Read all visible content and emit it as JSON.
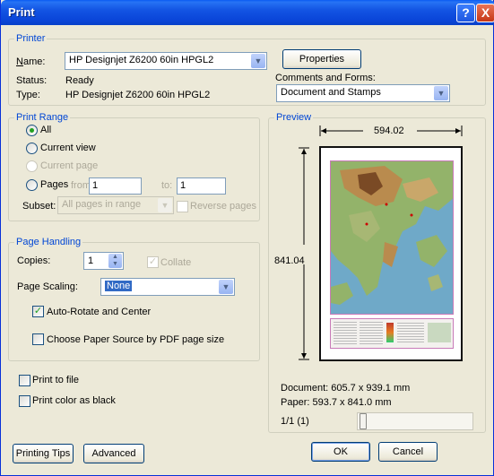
{
  "window": {
    "title": "Print",
    "help_label": "?",
    "close_label": "X"
  },
  "printer": {
    "group_label": "Printer",
    "name_label": "Name:",
    "name_value": "HP Designjet Z6200 60in HPGL2",
    "status_label": "Status:",
    "status_value": "Ready",
    "type_label": "Type:",
    "type_value": "HP Designjet Z6200 60in HPGL2",
    "properties_label": "Properties",
    "comments_label": "Comments and Forms:",
    "comments_value": "Document and Stamps"
  },
  "print_range": {
    "group_label": "Print Range",
    "all_label": "All",
    "current_view_label": "Current view",
    "current_page_label": "Current page",
    "pages_label": "Pages",
    "from_label": "from:",
    "from_value": "1",
    "to_label": "to:",
    "to_value": "1",
    "subset_label": "Subset:",
    "subset_value": "All pages in range",
    "reverse_label": "Reverse pages"
  },
  "page_handling": {
    "group_label": "Page Handling",
    "copies_label": "Copies:",
    "copies_value": "1",
    "collate_label": "Collate",
    "scaling_label": "Page Scaling:",
    "scaling_value": "None",
    "auto_rotate_label": "Auto-Rotate and Center",
    "paper_source_label": "Choose Paper Source by PDF page size"
  },
  "options": {
    "print_to_file_label": "Print to file",
    "print_color_black_label": "Print color as black"
  },
  "preview": {
    "group_label": "Preview",
    "width_label": "594.02",
    "height_label": "841.04",
    "document_size": "Document: 605.7 x 939.1 mm",
    "paper_size": "Paper: 593.7 x 841.0 mm",
    "page_indicator": "1/1 (1)",
    "page_slider_position": 0
  },
  "footer": {
    "printing_tips_label": "Printing Tips",
    "advanced_label": "Advanced",
    "ok_label": "OK",
    "cancel_label": "Cancel"
  },
  "colors": {
    "accent": "#0046d5",
    "titlebar": "#0a45d8"
  }
}
